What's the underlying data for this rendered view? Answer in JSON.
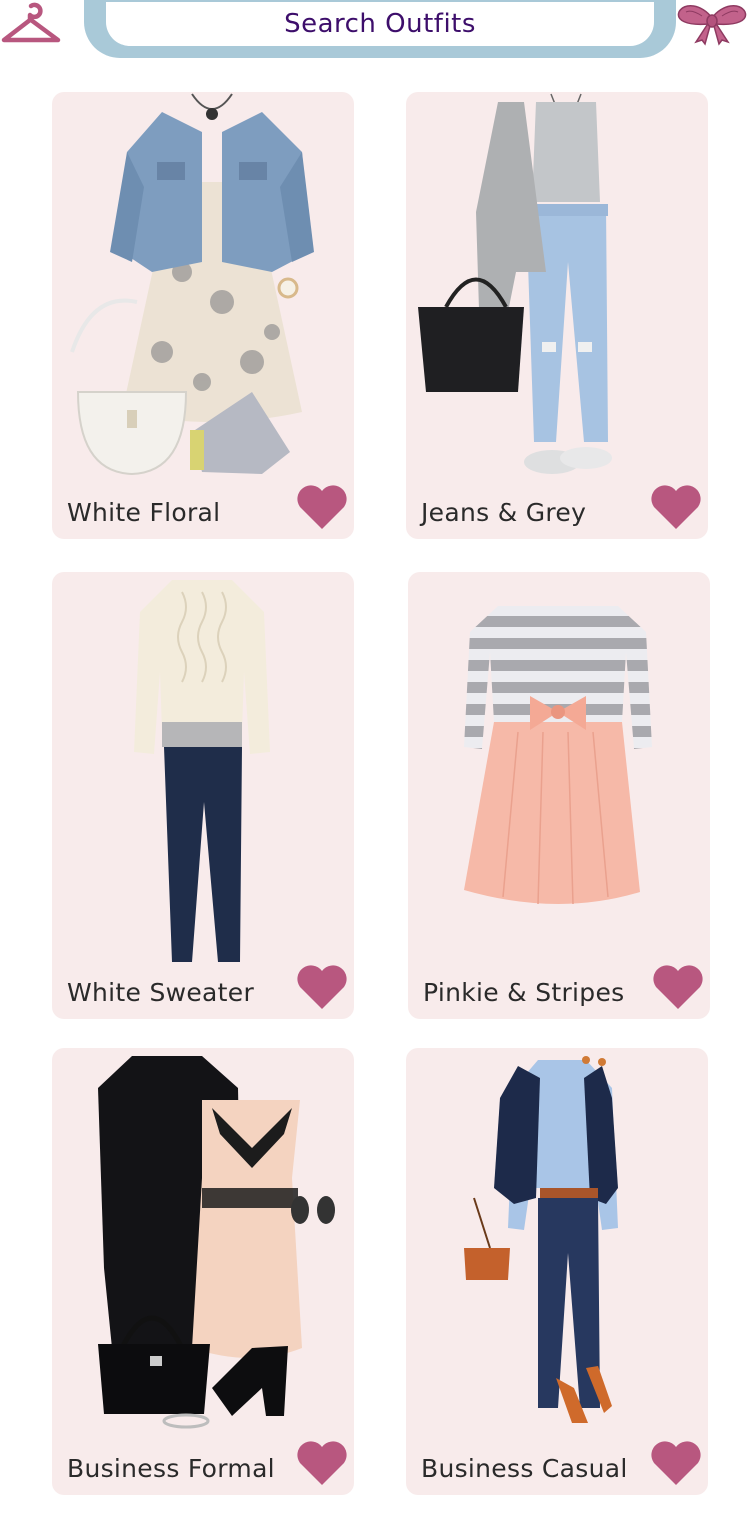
{
  "search": {
    "label": "Search Outfits",
    "frame_color": "#a9c9d8",
    "text_color": "#3d0e6b"
  },
  "icons": {
    "left": "hanger-icon",
    "right": "bow-icon",
    "favorite": "heart-icon"
  },
  "colors": {
    "card_background": "#f8ebeb",
    "accent": "#b8577f"
  },
  "outfits": [
    {
      "title": "White Floral"
    },
    {
      "title": "Jeans & Grey"
    },
    {
      "title": "White Sweater"
    },
    {
      "title": "Pinkie & Stripes"
    },
    {
      "title": "Business Formal"
    },
    {
      "title": "Business Casual"
    }
  ]
}
